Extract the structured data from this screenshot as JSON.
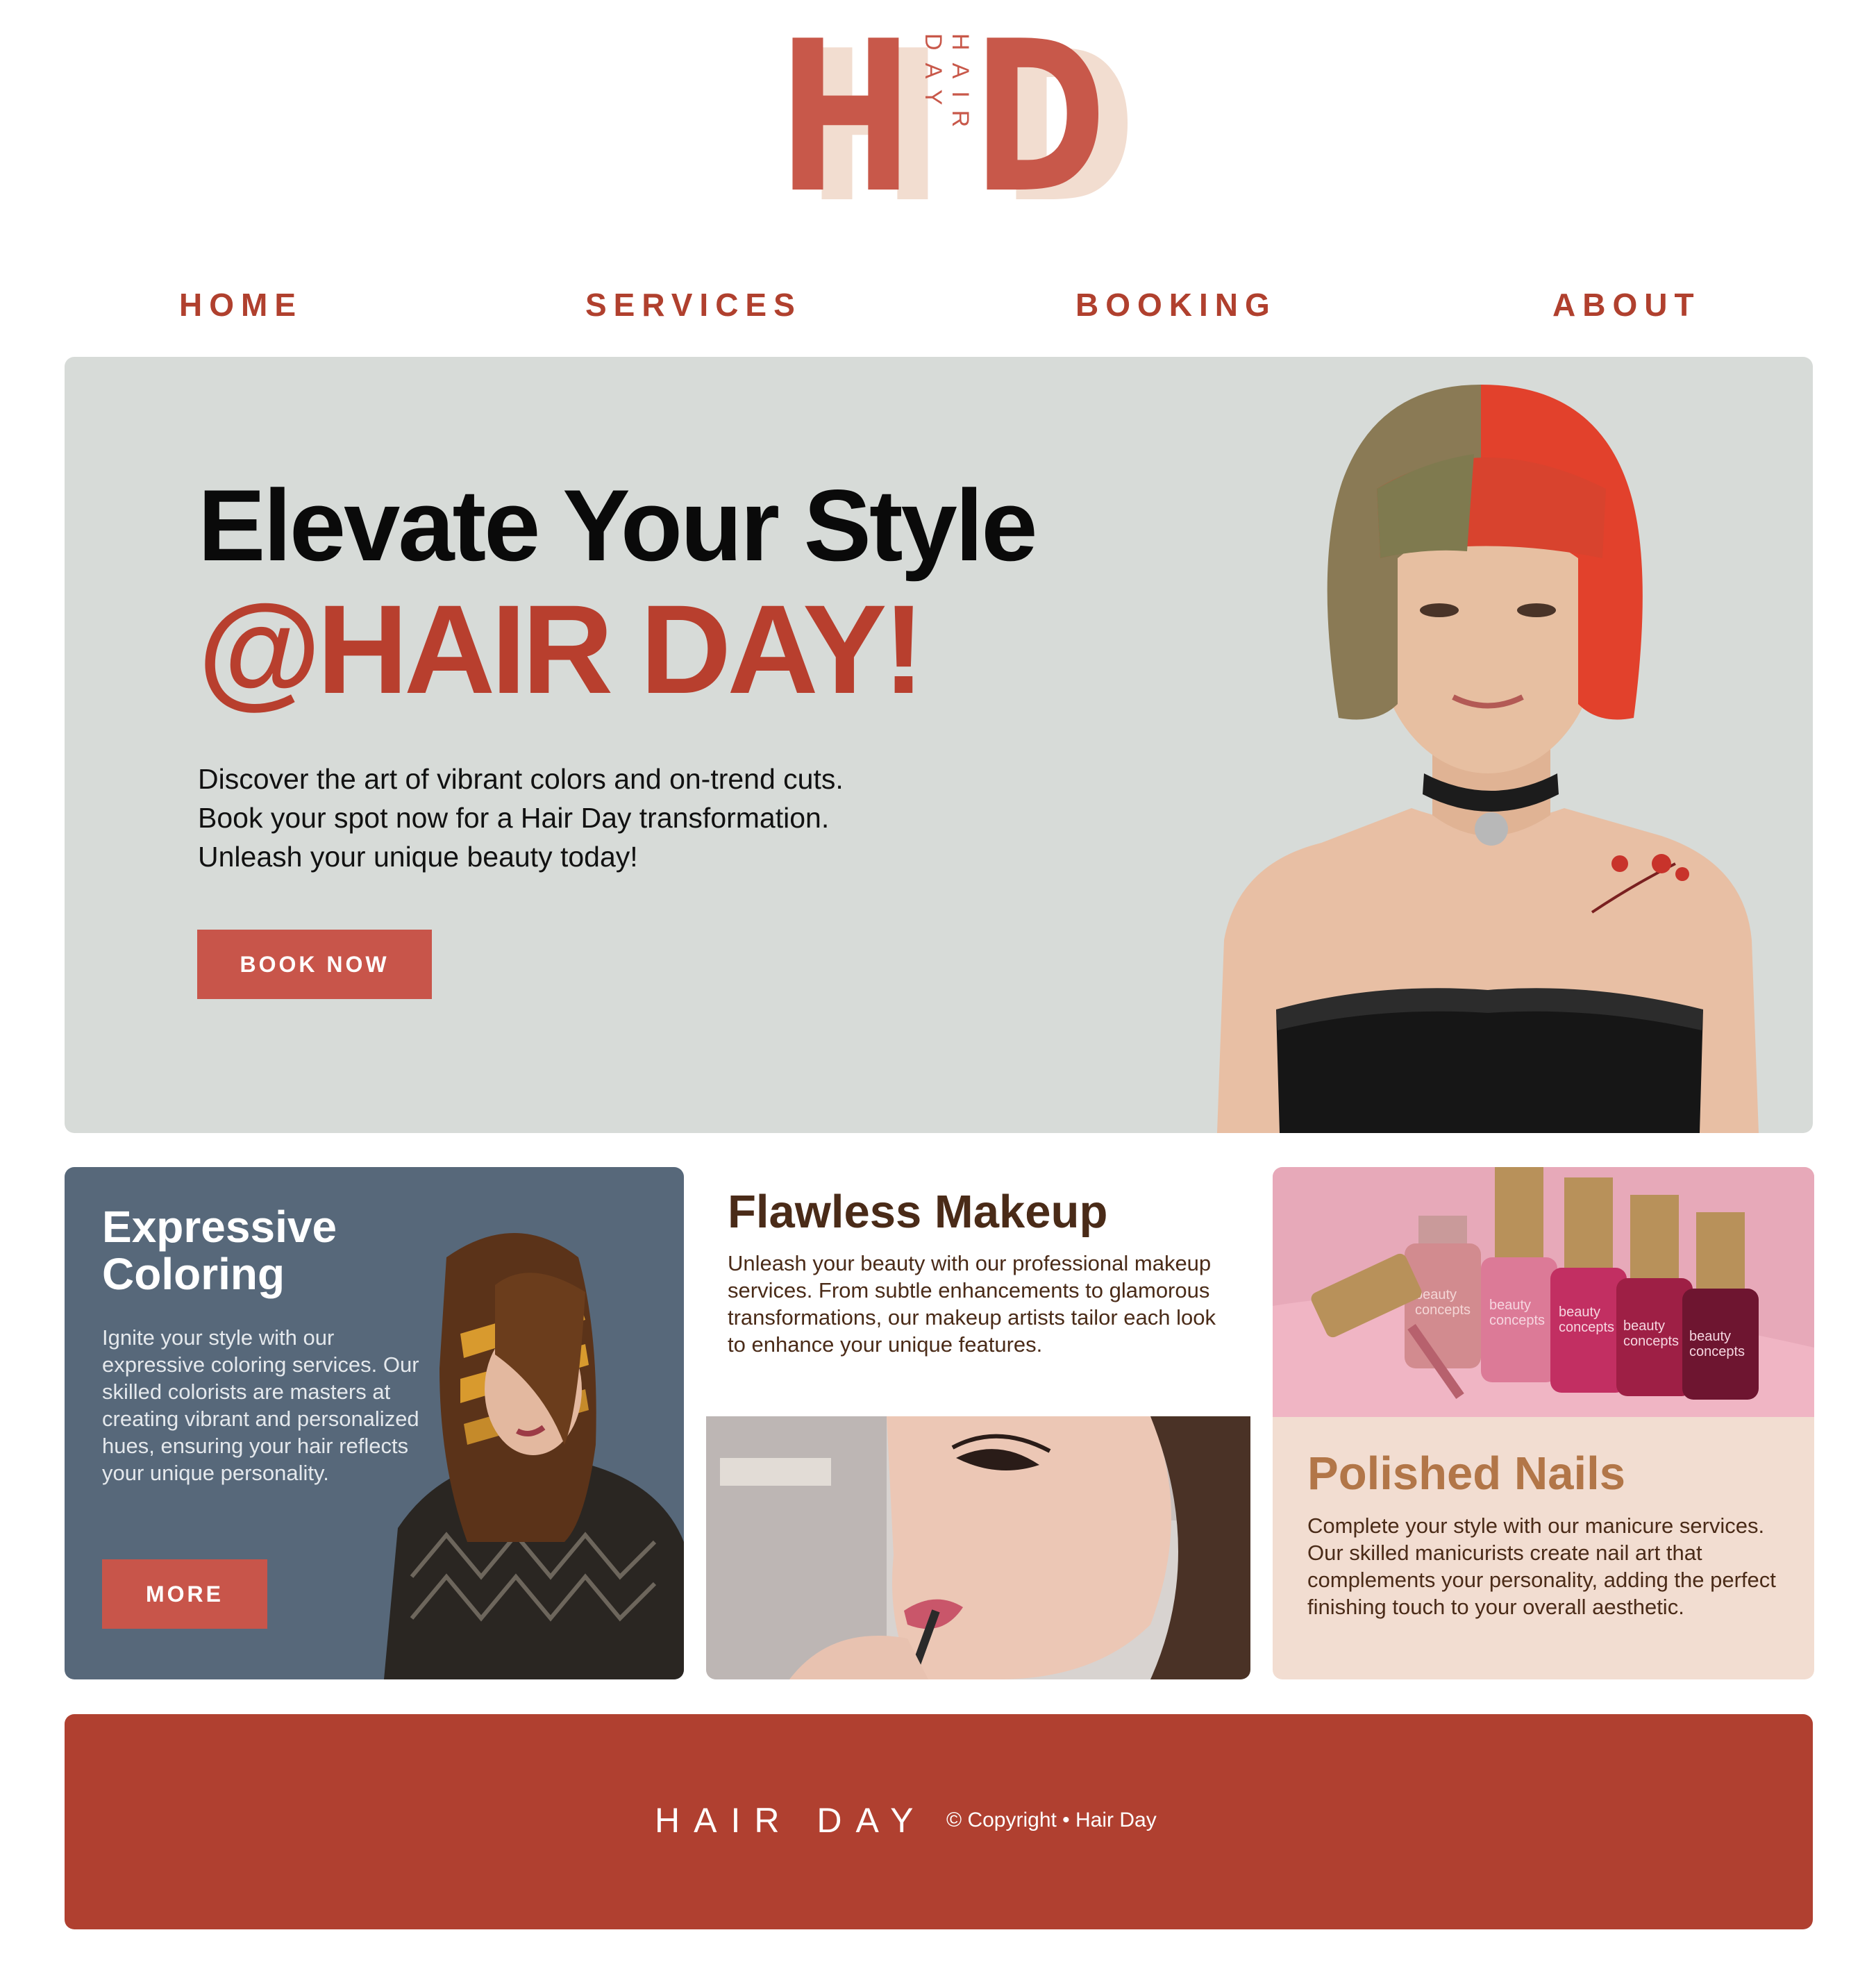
{
  "brand": {
    "logo_left": "H",
    "logo_right": "D",
    "logo_vertical": "HAIR DAY",
    "colors": {
      "primary": "#b0402e",
      "accent": "#c8584a",
      "blush": "#f2ddd1",
      "slate": "#57687a",
      "mist": "#d7dbd8",
      "brown": "#4a2b18",
      "caramel": "#b27648"
    }
  },
  "nav": {
    "items": [
      {
        "label": "HOME"
      },
      {
        "label": "SERVICES"
      },
      {
        "label": "BOOKING"
      },
      {
        "label": "ABOUT"
      }
    ]
  },
  "hero": {
    "title": "Elevate Your Style",
    "accent": "@HAIR DAY!",
    "lines": [
      "Discover the art of vibrant colors and on-trend cuts.",
      "Book your spot now for a Hair Day transformation.",
      "Unleash your unique beauty today!"
    ],
    "cta": "BOOK NOW"
  },
  "cards": [
    {
      "title": "Expressive Coloring",
      "text": "Ignite your style with our expressive coloring services. Our skilled colorists are masters at creating vibrant and personalized hues, ensuring your hair reflects your unique personality.",
      "button": "MORE"
    },
    {
      "title": "Flawless Makeup",
      "text": "Unleash your beauty with our professional makeup services. From subtle enhancements to glamorous transformations, our makeup artists tailor each look to enhance your unique features."
    },
    {
      "title": "Polished Nails",
      "text": "Complete your style with our manicure services. Our skilled manicurists create nail art that complements your personality, adding the perfect finishing touch to your overall aesthetic.",
      "image_text": [
        "beauty",
        "concepts"
      ]
    }
  ],
  "footer": {
    "brand": "HAIR DAY",
    "copyright": "© Copyright • Hair Day"
  }
}
